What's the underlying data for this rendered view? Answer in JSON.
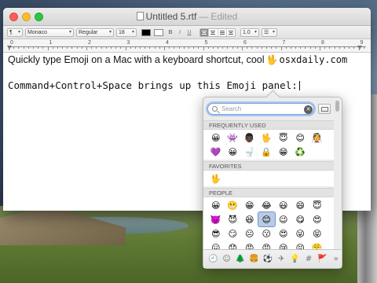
{
  "window": {
    "title": "Untitled 5.rtf",
    "separator": "—",
    "edited": "Edited"
  },
  "toolbar": {
    "paragraph_style": "¶",
    "font_family": "Monaco",
    "typeface": "Regular",
    "font_size": "18",
    "bold": "B",
    "italic": "I",
    "underline": "U",
    "line_spacing": "1.0",
    "text_color": "#000000",
    "highlight_color": "#ffffff"
  },
  "ruler": {
    "numbers": [
      "0",
      "1",
      "2",
      "3",
      "4",
      "5",
      "6",
      "7",
      "8",
      "9"
    ]
  },
  "document": {
    "line1_text": "Quickly type Emoji on a Mac with a keyboard shortcut, cool",
    "line1_emoji": "🖖",
    "line1_site": "osxdaily.com",
    "line2_text": "Command+Control+Space brings up this Emoji panel:"
  },
  "emoji_panel": {
    "search_placeholder": "Search",
    "sections": [
      {
        "title": "FREQUENTLY USED",
        "emojis": [
          "😀",
          "👾",
          "👨🏿",
          "🖖",
          "😇",
          "😊",
          "👰",
          "💜",
          "😀",
          "🚽",
          "🔒",
          "😁",
          "♻️"
        ]
      },
      {
        "title": "FAVORITES",
        "emojis": [
          "🖖"
        ]
      },
      {
        "title": "PEOPLE",
        "emojis": [
          "😀",
          "😬",
          "😁",
          "😂",
          "😃",
          "😄",
          "😇",
          "👿",
          "😈",
          "😆",
          "😊",
          "😉",
          "😋",
          "😍",
          "😎",
          "😏",
          "😐",
          "😗",
          "😍",
          "😜",
          "😝",
          "😖",
          "😟",
          "😠",
          "😡",
          "😢",
          "😣",
          "😤"
        ]
      }
    ],
    "categories": [
      "🕘",
      "☺",
      "🌲",
      "🍔",
      "⚽",
      "✈",
      "💡",
      "#",
      "🚩",
      "»"
    ]
  }
}
